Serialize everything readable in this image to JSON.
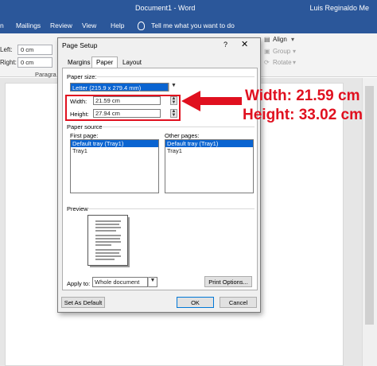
{
  "window": {
    "doc_title": "Document1 - Word",
    "user": "Luis Reginaldo Me"
  },
  "ribbon": {
    "tabs": [
      "n",
      "Mailings",
      "Review",
      "View",
      "Help"
    ],
    "tell_me": "Tell me what you want to do",
    "indent": {
      "left_label": "Left:",
      "left_value": "0 cm",
      "right_label": "Right:",
      "right_value": "0 cm",
      "group_label": "Paragra"
    },
    "arrange": {
      "align": "Align",
      "group": "Group",
      "rotate": "Rotate"
    }
  },
  "dialog": {
    "title": "Page Setup",
    "help": "?",
    "close": "✕",
    "tabs": [
      "Margins",
      "Paper",
      "Layout"
    ],
    "active_tab": "Paper",
    "paper_size": {
      "label": "Paper size:",
      "selected": "Letter (215.9 x 279.4 mm)",
      "width_label": "Width:",
      "width_value": "21.59 cm",
      "height_label": "Height:",
      "height_value": "27.94 cm"
    },
    "paper_source": {
      "label": "Paper source",
      "first_page_label": "First page:",
      "first_page_items": [
        "Default tray (Tray1)",
        "Tray1"
      ],
      "other_pages_label": "Other pages:",
      "other_pages_items": [
        "Default tray (Tray1)",
        "Tray1"
      ]
    },
    "preview_label": "Preview",
    "apply_to_label": "Apply to:",
    "apply_to_value": "Whole document",
    "print_options": "Print Options...",
    "set_default": "Set As Default",
    "ok": "OK",
    "cancel": "Cancel"
  },
  "annotation": {
    "width_text": "Width: 21.59 cm",
    "height_text": "Height: 33.02 cm",
    "color": "#e0101f"
  }
}
